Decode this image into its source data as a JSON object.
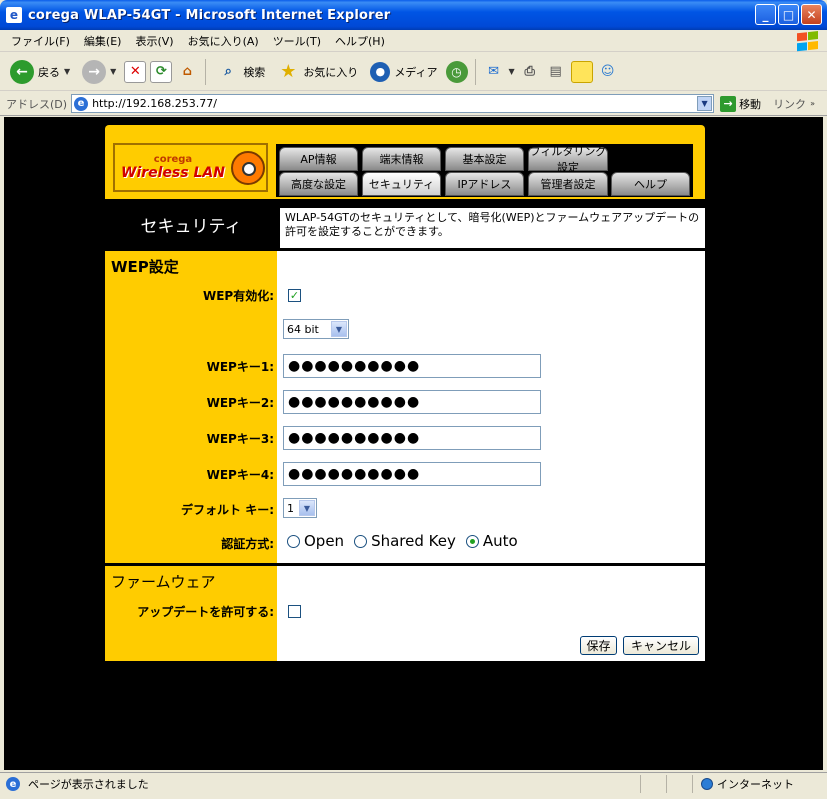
{
  "window": {
    "title": "corega WLAP-54GT - Microsoft Internet Explorer"
  },
  "menu": [
    "ファイル(F)",
    "編集(E)",
    "表示(V)",
    "お気に入り(A)",
    "ツール(T)",
    "ヘルプ(H)"
  ],
  "toolbar": {
    "back": "戻る",
    "search": "検索",
    "favorites": "お気に入り",
    "media": "メディア"
  },
  "address": {
    "label": "アドレス(D)",
    "url": "http://192.168.253.77/",
    "go": "移動",
    "links": "リンク"
  },
  "logo": {
    "brand": "corega",
    "product": "Wireless LAN"
  },
  "tabs": {
    "row1": [
      "AP情報",
      "端末情報",
      "基本設定",
      "フィルタリング設定"
    ],
    "row2": [
      "高度な設定",
      "セキュリティ",
      "IPアドレス",
      "管理者設定",
      "ヘルプ"
    ]
  },
  "page": {
    "title": "セキュリティ",
    "description": "WLAP-54GTのセキュリティとして、暗号化(WEP)とファームウェアアップデートの許可を設定することができます。"
  },
  "wep": {
    "heading": "WEP設定",
    "enable_label": "WEP有効化:",
    "enable_checked": "✓",
    "bits_value": "64 bit",
    "key1_label": "WEPキー1:",
    "key2_label": "WEPキー2:",
    "key3_label": "WEPキー3:",
    "key4_label": "WEPキー4:",
    "key1_value": "●●●●●●●●●●",
    "key2_value": "●●●●●●●●●●",
    "key3_value": "●●●●●●●●●●",
    "key4_value": "●●●●●●●●●●",
    "default_key_label": "デフォルト キー:",
    "default_key_value": "1",
    "auth_label": "認証方式:",
    "auth_open": "Open",
    "auth_shared": "Shared Key",
    "auth_auto": "Auto",
    "auth_selected": "Auto"
  },
  "firmware": {
    "heading": "ファームウェア",
    "allow_label": "アップデートを許可する:",
    "allow_checked": false
  },
  "buttons": {
    "save": "保存",
    "cancel": "キャンセル"
  },
  "status": {
    "text": "ページが表示されました",
    "zone": "インターネット"
  }
}
